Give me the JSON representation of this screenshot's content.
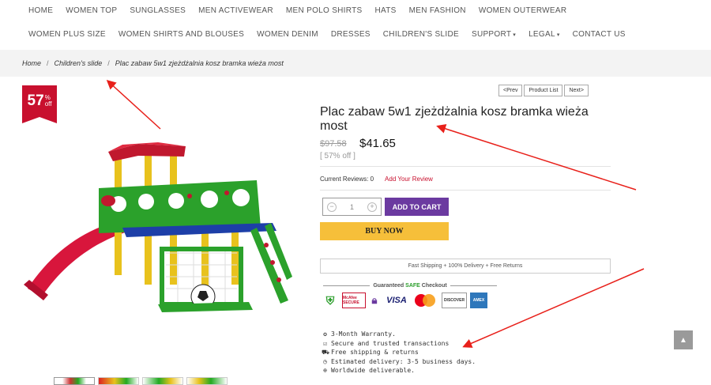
{
  "nav": {
    "row1": [
      "HOME",
      "WOMEN TOP",
      "SUNGLASSES",
      "MEN ACTIVEWEAR",
      "MEN POLO SHIRTS",
      "HATS",
      "MEN FASHION",
      "WOMEN OUTERWEAR"
    ],
    "row2": [
      "WOMEN PLUS SIZE",
      "WOMEN SHIRTS AND BLOUSES",
      "WOMEN DENIM",
      "DRESSES",
      "CHILDREN'S SLIDE"
    ],
    "support": "SUPPORT",
    "legal": "LEGAL",
    "contact": "CONTACT US"
  },
  "breadcrumb": {
    "home": "Home",
    "category": "Children's slide",
    "current": "Plac zabaw 5w1 zjeżdżalnia kosz bramka wieża most"
  },
  "badge": {
    "number": "57",
    "percent": "%",
    "off": "off"
  },
  "pager": {
    "prev": "<Prev",
    "list": "Product List",
    "next": "Next>"
  },
  "product": {
    "title": "Plac zabaw 5w1 zjeżdżalnia kosz bramka wieża most",
    "price_old": "$97.58",
    "price_new": "$41.65",
    "discount": "[ 57% off ]",
    "reviews_label": "Current Reviews: 0",
    "add_review": "Add Your Review",
    "qty": "1",
    "add_to_cart": "ADD TO CART",
    "buy_now": "BUY NOW"
  },
  "shipping_text": "Fast Shipping + 100% Delivery + Free Returns",
  "checkout": {
    "title_pre": "Guaranteed",
    "title_safe": "SAFE",
    "title_post": "Checkout",
    "mcafee": "McAfee SECURE",
    "visa": "VISA",
    "discover": "DISCOVER",
    "amex": "AMEX"
  },
  "features": [
    {
      "icon": "award-icon",
      "glyph": "✪",
      "text": "3-Month Warranty."
    },
    {
      "icon": "check-icon",
      "glyph": "☑",
      "text": "Secure and trusted transactions"
    },
    {
      "icon": "truck-icon",
      "glyph": "⛟",
      "text": "Free shipping & returns"
    },
    {
      "icon": "clock-icon",
      "glyph": "◷",
      "text": "Estimated delivery: 3-5 business days."
    },
    {
      "icon": "globe-icon",
      "glyph": "⊕",
      "text": "Worldwide deliverable."
    }
  ],
  "scroll_top_icon": "chevron-up-icon",
  "colors": {
    "accent": "#6b3aa0",
    "buy": "#f6bf3a",
    "sale": "#c8102e",
    "annotation": "#e8201a"
  }
}
